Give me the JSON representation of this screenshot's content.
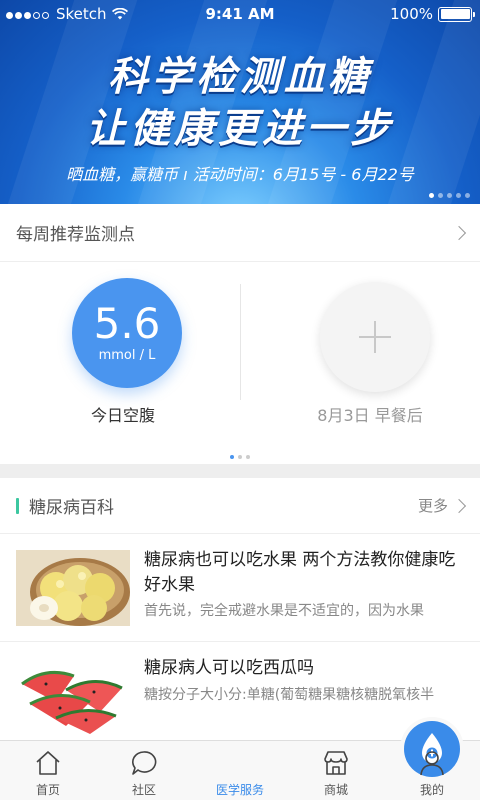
{
  "status_bar": {
    "carrier": "Sketch",
    "time": "9:41 AM",
    "battery": "100%"
  },
  "banner": {
    "line1": "科学检测血糖",
    "line2": "让健康更进一步",
    "subtitle": "晒血糖，赢糖币  ı  活动时间：6月15号 - 6月22号",
    "slide_count": 5,
    "active_slide": 0
  },
  "weekly": {
    "title": "每周推荐监测点",
    "reading": {
      "value": "5.6",
      "unit": "mmol / L",
      "label": "今日空腹"
    },
    "next": {
      "label": "8月3日  早餐后"
    },
    "page_count": 3,
    "active_page": 0
  },
  "encyclopedia": {
    "title": "糖尿病百科",
    "more": "更多",
    "articles": [
      {
        "title": "糖尿病也可以吃水果 两个方法教你健康吃好水果",
        "desc": "首先说，完全戒避水果是不适宜的，因为水果",
        "thumb": "pear-image"
      },
      {
        "title": "糖尿病人可以吃西瓜吗",
        "desc": "糖按分子大小分:单糖(葡萄糖果糖核糖脱氧核半",
        "thumb": "watermelon-image"
      }
    ]
  },
  "tabbar": {
    "tabs": [
      {
        "label": "首页",
        "icon": "home-icon"
      },
      {
        "label": "社区",
        "icon": "chat-bubble-icon"
      },
      {
        "label": "医学服务",
        "icon": "medical-drop-icon"
      },
      {
        "label": "商城",
        "icon": "store-icon"
      },
      {
        "label": "我的",
        "icon": "person-icon"
      }
    ],
    "active_index": 2
  },
  "colors": {
    "accent": "#3a8be9",
    "reading": "#4a95ef",
    "section_bar": "#3cc7a0"
  }
}
